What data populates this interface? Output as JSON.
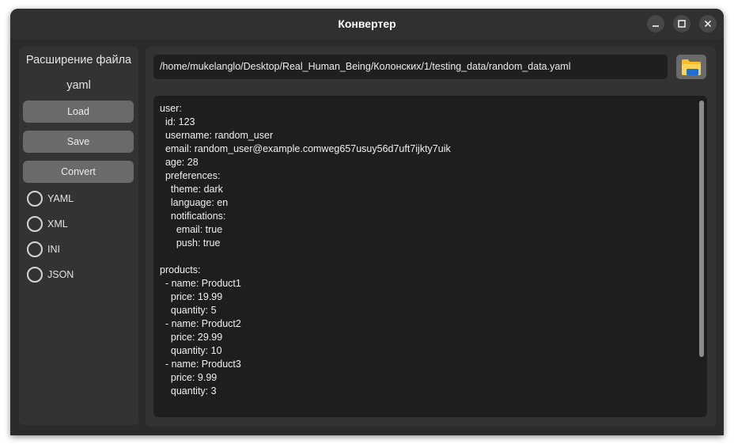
{
  "window": {
    "title": "Конвертер",
    "minimize_icon": "minimize-icon",
    "maximize_icon": "maximize-icon",
    "close_icon": "close-icon"
  },
  "sidebar": {
    "extension_label": "Расширение файла",
    "extension_value": "yaml",
    "load_label": "Load",
    "save_label": "Save",
    "convert_label": "Convert",
    "formats": [
      {
        "label": "YAML",
        "selected": false
      },
      {
        "label": "XML",
        "selected": false
      },
      {
        "label": "INI",
        "selected": false
      },
      {
        "label": "JSON",
        "selected": false
      }
    ]
  },
  "main": {
    "path": "/home/mukelanglo/Desktop/Real_Human_Being/Колонских/1/testing_data/random_data.yaml",
    "folder_icon": "folder-icon",
    "content": "user:\n  id: 123\n  username: random_user\n  email: random_user@example.comweg657usuy56d7uft7ijkty7uik\n  age: 28\n  preferences:\n    theme: dark\n    language: en\n    notifications:\n      email: true\n      push: true\n\nproducts:\n  - name: Product1\n    price: 19.99\n    quantity: 5\n  - name: Product2\n    price: 29.99\n    quantity: 10\n  - name: Product3\n    price: 9.99\n    quantity: 3"
  },
  "colors": {
    "window_bg": "#2b2b2b",
    "panel_bg": "#333333",
    "button_bg": "#6a6a6a",
    "editor_bg": "#1e1e1e",
    "folder_yellow": "#f5c02c",
    "folder_blue": "#1e6fd0"
  }
}
